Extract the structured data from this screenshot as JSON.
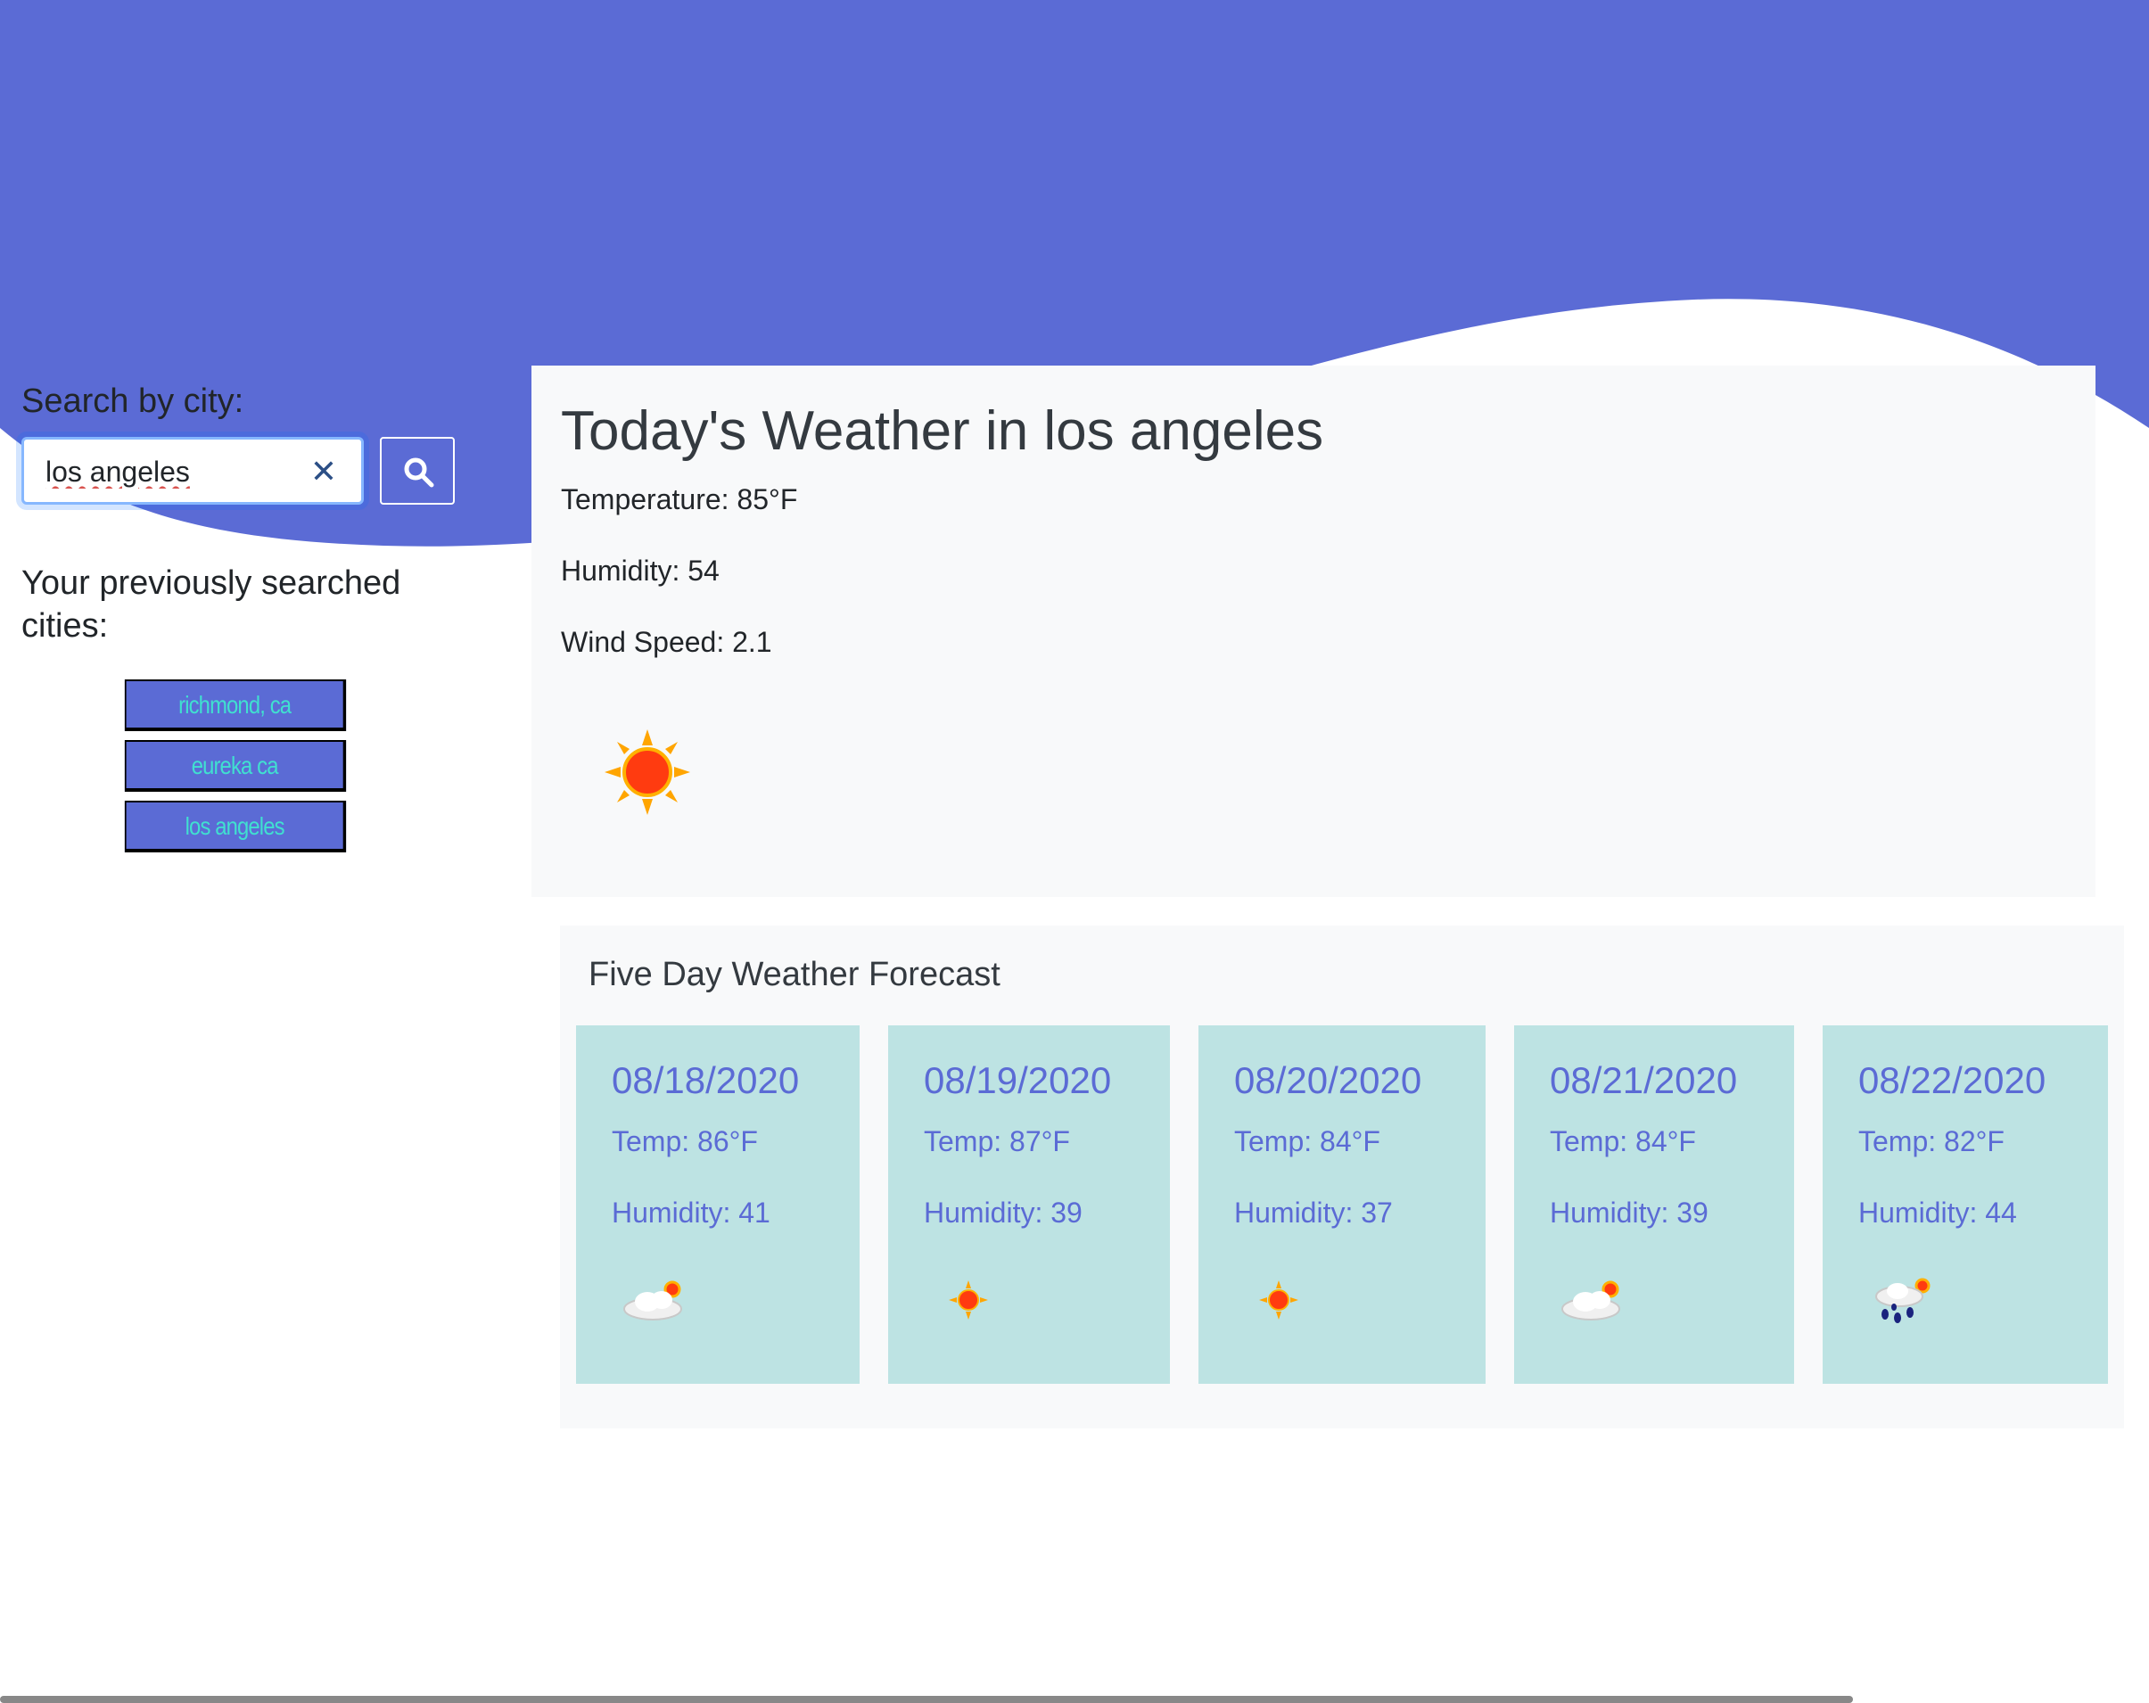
{
  "colors": {
    "header_wave": "#5b6bd5",
    "card_background": "#f8f9fa",
    "forecast_card": "#bde3e3",
    "accent_text": "#5b6bd5",
    "history_text": "#40e0d0"
  },
  "search": {
    "label": "Search by city:",
    "value": "los angeles",
    "clear_icon": "close-icon",
    "button_icon": "search-icon"
  },
  "history": {
    "heading": "Your previously searched cities:",
    "items": [
      {
        "label": "richmond, ca"
      },
      {
        "label": "eureka ca"
      },
      {
        "label": "los angeles"
      }
    ]
  },
  "today": {
    "title": "Today's Weather in los angeles",
    "temperature": "Temperature: 85°F",
    "humidity": "Humidity: 54",
    "wind": "Wind Speed: 2.1",
    "icon": "sun-icon"
  },
  "forecast": {
    "title": "Five Day Weather Forecast",
    "days": [
      {
        "date": "08/18/2020",
        "temp": "Temp: 86°F",
        "humidity": "Humidity: 41",
        "icon": "partly-cloudy-icon"
      },
      {
        "date": "08/19/2020",
        "temp": "Temp: 87°F",
        "humidity": "Humidity: 39",
        "icon": "sun-icon"
      },
      {
        "date": "08/20/2020",
        "temp": "Temp: 84°F",
        "humidity": "Humidity: 37",
        "icon": "sun-icon"
      },
      {
        "date": "08/21/2020",
        "temp": "Temp: 84°F",
        "humidity": "Humidity: 39",
        "icon": "partly-cloudy-icon"
      },
      {
        "date": "08/22/2020",
        "temp": "Temp: 82°F",
        "humidity": "Humidity: 44",
        "icon": "rain-sun-icon"
      }
    ]
  }
}
